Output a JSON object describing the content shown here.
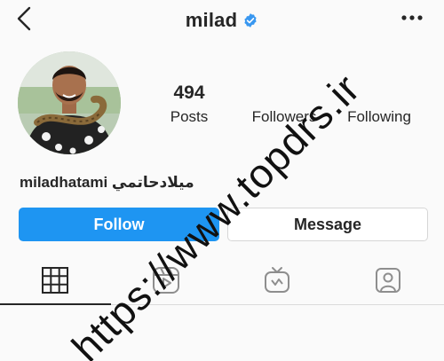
{
  "header": {
    "title": "milad",
    "back_icon": "chevron-left-icon",
    "verified_icon": "verified-badge-icon",
    "more_icon": "more-horizontal-icon"
  },
  "profile": {
    "name": "miladhatami ميلادحاتمي",
    "stats": [
      {
        "value": "494",
        "label": "Posts"
      },
      {
        "value": "",
        "label": "Followers"
      },
      {
        "value": "",
        "label": "Following"
      }
    ]
  },
  "actions": {
    "follow_label": "Follow",
    "message_label": "Message"
  },
  "tabs": [
    {
      "icon": "grid-icon",
      "active": true
    },
    {
      "icon": "reels-icon",
      "active": false
    },
    {
      "icon": "igtv-icon",
      "active": false
    },
    {
      "icon": "tagged-icon",
      "active": false
    }
  ],
  "watermark": "https://www.topdrs.ir",
  "colors": {
    "accent": "#1e95f2",
    "verified": "#3897f0",
    "text": "#262626",
    "background": "#fafafa"
  }
}
